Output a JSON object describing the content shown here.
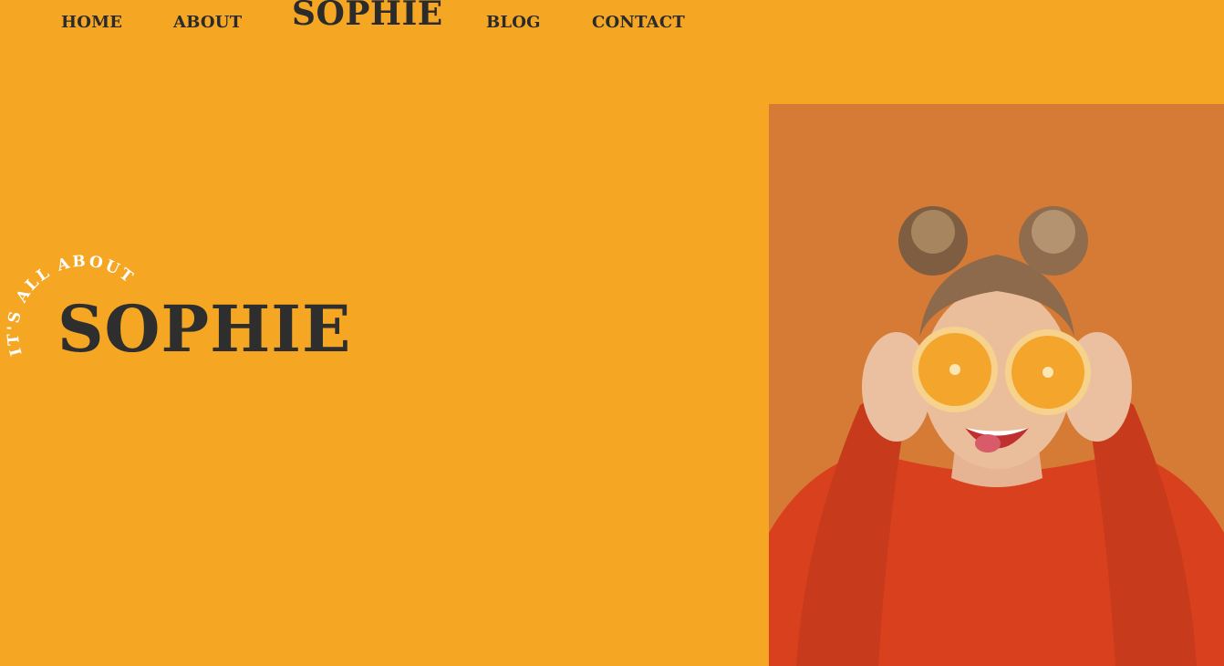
{
  "nav": {
    "home": "HOME",
    "about": "ABOUT",
    "logo": "SOPHIE",
    "blog": "BLOG",
    "contact": "CONTACT"
  },
  "hero": {
    "tagline": "IT'S ALL ABOUT",
    "title": "SOPHIE"
  },
  "colors": {
    "background": "#F5A623",
    "text": "#2E2E2E",
    "tagline": "#FFFFFF",
    "photo_background": "#D67B35",
    "sweater": "#D9411E",
    "orange": "#F4A52B"
  },
  "photo": {
    "icon": "portrait-photo"
  }
}
